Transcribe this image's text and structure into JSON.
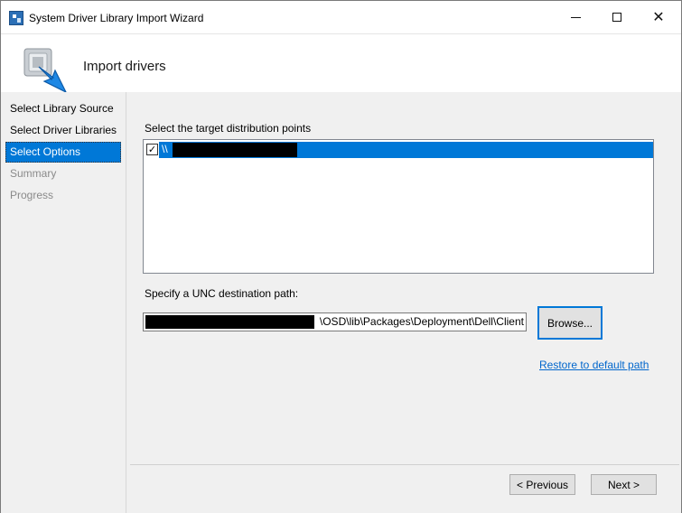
{
  "window": {
    "title": "System Driver Library Import Wizard",
    "controls": {
      "minimize": "—",
      "maximize": "☐",
      "close": "✕"
    }
  },
  "header": {
    "title": "Import drivers",
    "icon": "driver-import-arrow-icon"
  },
  "sidebar": {
    "steps": [
      {
        "label": "Select Library Source",
        "state": "normal"
      },
      {
        "label": "Select Driver Libraries",
        "state": "normal"
      },
      {
        "label": "Select Options",
        "state": "active"
      },
      {
        "label": "Summary",
        "state": "disabled"
      },
      {
        "label": "Progress",
        "state": "disabled"
      }
    ]
  },
  "main": {
    "distribution_label": "Select the target distribution points",
    "distribution_points": [
      {
        "text": "\\\\",
        "checked": true,
        "selected": true
      }
    ],
    "unc_label": "Specify a UNC destination path:",
    "unc_path_visible": "\\OSD\\lib\\Packages\\Deployment\\Dell\\Client",
    "browse_label": "Browse...",
    "restore_link": "Restore to default path",
    "previous_label": "< Previous",
    "next_label": "Next >"
  },
  "colors": {
    "accent": "#0078d7",
    "panel": "#f0f0f0",
    "link": "#0066cc"
  }
}
